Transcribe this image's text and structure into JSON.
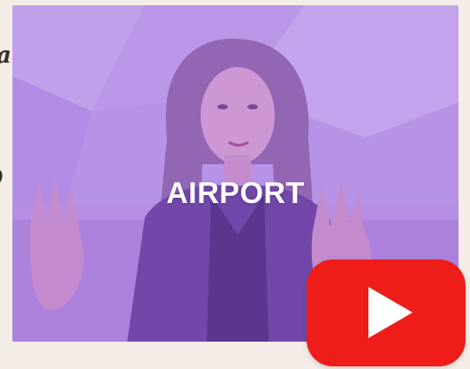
{
  "video": {
    "caption": "AIRPORT",
    "overlay_color": "#9b59e6"
  },
  "player": {
    "play_button_color": "#ee1d1a",
    "play_icon": "play-icon"
  },
  "page": {
    "background": "#f4ece6"
  }
}
